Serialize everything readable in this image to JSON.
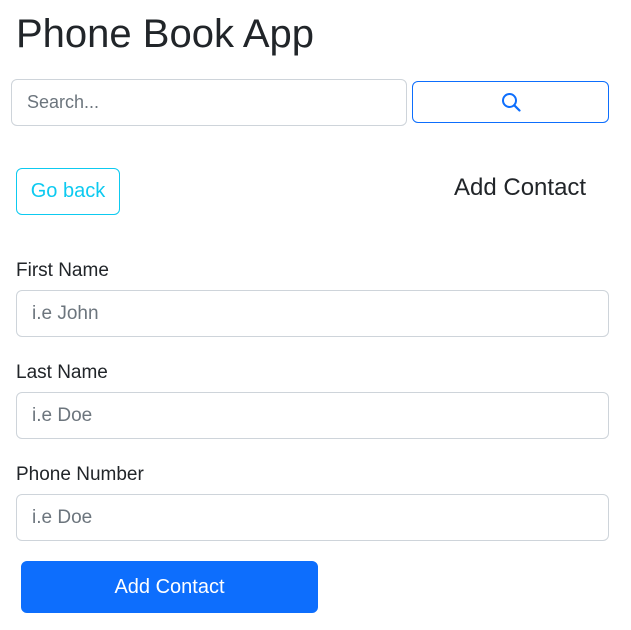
{
  "app": {
    "title": "Phone Book App"
  },
  "search": {
    "placeholder": "Search...",
    "value": "",
    "button_icon": "search-icon"
  },
  "nav": {
    "back_label": "Go back",
    "section_title": "Add Contact"
  },
  "form": {
    "first_name": {
      "label": "First Name",
      "placeholder": "i.e John",
      "value": ""
    },
    "last_name": {
      "label": "Last Name",
      "placeholder": "i.e Doe",
      "value": ""
    },
    "phone_number": {
      "label": "Phone Number",
      "placeholder": "i.e Doe",
      "value": ""
    },
    "submit_label": "Add Contact"
  },
  "colors": {
    "primary": "#0d6efd",
    "info": "#0dcaf0",
    "text": "#212529",
    "placeholder": "#6c757d",
    "border": "#ced4da"
  }
}
